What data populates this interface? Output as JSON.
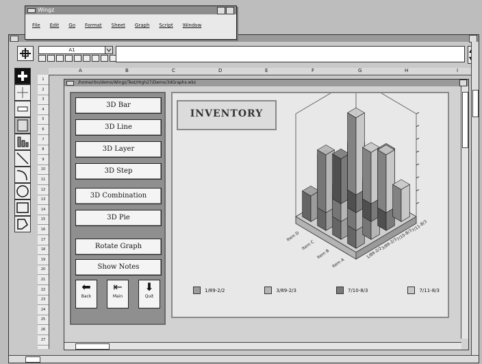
{
  "menu_window": {
    "title": "Wingz",
    "menus": [
      "File",
      "Edit",
      "Go",
      "Format",
      "Sheet",
      "Graph",
      "Script",
      "Window"
    ]
  },
  "toolbar": {
    "cell_ref": "A1"
  },
  "columns": [
    "A",
    "B",
    "C",
    "D",
    "E",
    "F",
    "G",
    "H",
    "I"
  ],
  "rows": [
    "1",
    "2",
    "3",
    "4",
    "5",
    "6",
    "7",
    "8",
    "9",
    "10",
    "11",
    "12",
    "13",
    "14",
    "15",
    "16",
    "17",
    "18",
    "19",
    "20",
    "21",
    "22",
    "23",
    "24",
    "25",
    "26",
    "27"
  ],
  "document": {
    "title": "/home/rbn/demo/Wingz/Test/High27/Demo/3dGraphs.wkz"
  },
  "buttons": {
    "b3d_bar": "3D Bar",
    "b3d_line": "3D Line",
    "b3d_layer": "3D Layer",
    "b3d_step": "3D Step",
    "b3d_combination": "3D Combination",
    "b3d_pie": "3D Pie",
    "rotate_graph": "Rotate Graph",
    "show_notes": "Show Notes",
    "back": "Back",
    "main": "Main",
    "quit": "Quit"
  },
  "chart_data": {
    "type": "bar",
    "title": "INVENTORY",
    "categories": [
      "Item A",
      "Item B",
      "Item C",
      "Item D"
    ],
    "series": [
      {
        "name": "1/89-2/2",
        "values": [
          35,
          30,
          55,
          20
        ]
      },
      {
        "name": "3/89-2/3",
        "values": [
          40,
          65,
          25,
          45
        ]
      },
      {
        "name": "7/10-8/3",
        "values": [
          60,
          30,
          50,
          35
        ]
      },
      {
        "name": "7/11-8/3",
        "values": [
          25,
          45,
          40,
          60
        ]
      }
    ],
    "zlim": [
      0,
      80
    ],
    "legend_position": "bottom",
    "colors": [
      "#9c9c9c",
      "#b5b5b5",
      "#7a7a7a",
      "#c8c8c8"
    ]
  }
}
